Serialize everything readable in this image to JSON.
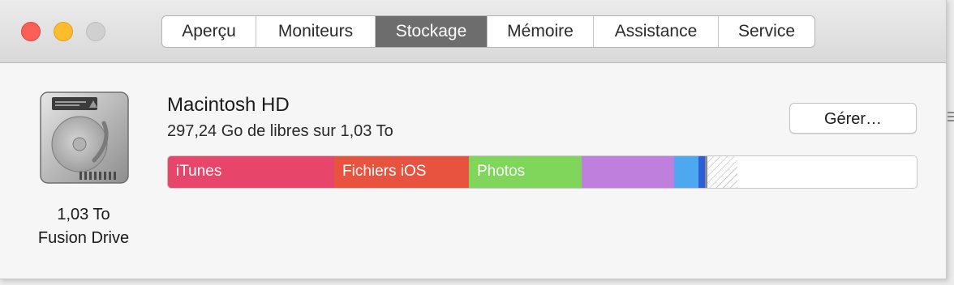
{
  "window": {
    "traffic_lights": [
      "close",
      "minimize",
      "zoom"
    ]
  },
  "tabs": [
    {
      "label": "Aperçu",
      "active": false
    },
    {
      "label": "Moniteurs",
      "active": false
    },
    {
      "label": "Stockage",
      "active": true
    },
    {
      "label": "Mémoire",
      "active": false
    },
    {
      "label": "Assistance",
      "active": false
    },
    {
      "label": "Service",
      "active": false
    }
  ],
  "disk": {
    "icon": "hard-drive-icon",
    "size": "1,03 To",
    "type": "Fusion Drive"
  },
  "volume": {
    "name": "Macintosh HD",
    "free_text": "297,24 Go de libres sur 1,03 To",
    "manage_label": "Gérer…"
  },
  "storage_bar": {
    "segments": [
      {
        "label": "iTunes",
        "color": "#e8456b",
        "fraction": 0.222
      },
      {
        "label": "Fichiers iOS",
        "color": "#e8533f",
        "fraction": 0.18
      },
      {
        "label": "Photos",
        "color": "#7fd65b",
        "fraction": 0.151
      },
      {
        "label": "",
        "color": "#bf7fdc",
        "fraction": 0.123
      },
      {
        "label": "",
        "color": "#4ea8ef",
        "fraction": 0.032
      },
      {
        "label": "",
        "color": "#2f5fd8",
        "fraction": 0.009
      },
      {
        "label": "",
        "color": "#8a8a8a",
        "fraction": 0.003
      },
      {
        "label": "",
        "color": "hatch",
        "fraction": 0.04
      },
      {
        "label": "",
        "color": "#ffffff",
        "fraction": 0.24
      }
    ]
  }
}
